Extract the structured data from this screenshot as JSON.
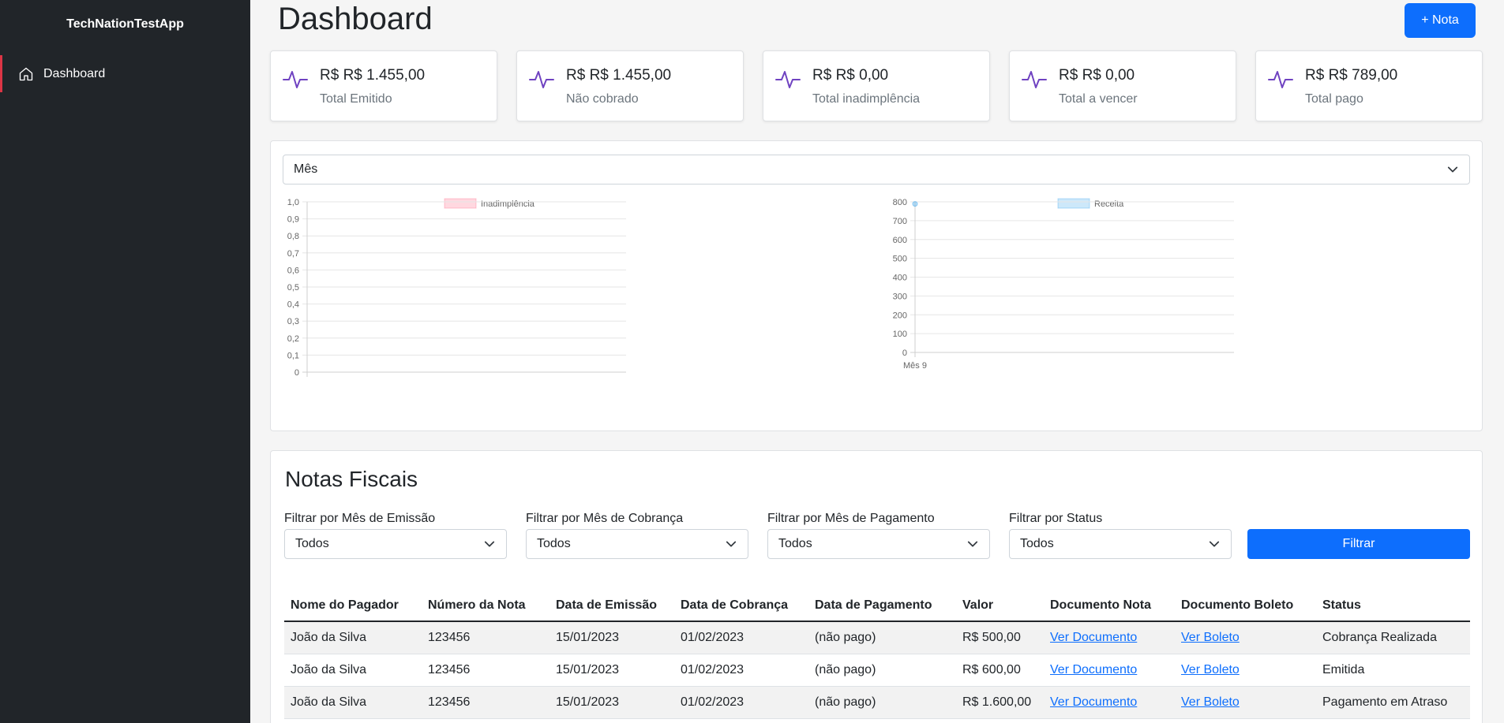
{
  "app": {
    "title": "TechNationTestApp"
  },
  "sidebar": {
    "items": [
      {
        "label": "Dashboard",
        "icon": "home-icon"
      }
    ]
  },
  "header": {
    "title": "Dashboard",
    "new_button": "+ Nota"
  },
  "summary_cards": [
    {
      "value": "R$ R$ 1.455,00",
      "label": "Total Emitido",
      "icon": "activity-icon"
    },
    {
      "value": "R$ R$ 1.455,00",
      "label": "Não cobrado",
      "icon": "activity-icon"
    },
    {
      "value": "R$ R$ 0,00",
      "label": "Total inadimplência",
      "icon": "activity-icon"
    },
    {
      "value": "R$ R$ 0,00",
      "label": "Total a vencer",
      "icon": "activity-icon"
    },
    {
      "value": "R$ R$ 789,00",
      "label": "Total pago",
      "icon": "activity-icon"
    }
  ],
  "period_select": {
    "value": "Mês"
  },
  "chart_data": [
    {
      "type": "line",
      "legend": "Inadimplência",
      "categories": [],
      "series": [
        {
          "name": "Inadimplência",
          "values": []
        }
      ],
      "yticks": [
        "1,0",
        "0,9",
        "0,8",
        "0,7",
        "0,6",
        "0,5",
        "0,4",
        "0,3",
        "0,2",
        "0,1",
        "0"
      ],
      "ylim": [
        0,
        1
      ],
      "grid": true,
      "legend_position": "top",
      "color": "#ff6384"
    },
    {
      "type": "line",
      "legend": "Receita",
      "categories": [
        "Mês 9"
      ],
      "series": [
        {
          "name": "Receita",
          "values": [
            789
          ]
        }
      ],
      "yticks": [
        "800",
        "700",
        "600",
        "500",
        "400",
        "300",
        "200",
        "100",
        "0"
      ],
      "ylim": [
        0,
        800
      ],
      "grid": true,
      "legend_position": "top",
      "color": "#36a2eb"
    }
  ],
  "notas": {
    "title": "Notas Fiscais",
    "filters": [
      {
        "label": "Filtrar por Mês de Emissão",
        "value": "Todos"
      },
      {
        "label": "Filtrar por Mês de Cobrança",
        "value": "Todos"
      },
      {
        "label": "Filtrar por Mês de Pagamento",
        "value": "Todos"
      },
      {
        "label": "Filtrar por Status",
        "value": "Todos"
      }
    ],
    "filter_button": "Filtrar",
    "columns": [
      "Nome do Pagador",
      "Número da Nota",
      "Data de Emissão",
      "Data de Cobrança",
      "Data de Pagamento",
      "Valor",
      "Documento Nota",
      "Documento Boleto",
      "Status"
    ],
    "rows": [
      [
        "João da Silva",
        "123456",
        "15/01/2023",
        "01/02/2023",
        "(não pago)",
        "R$ 500,00",
        "Ver Documento",
        "Ver Boleto",
        "Cobrança Realizada"
      ],
      [
        "João da Silva",
        "123456",
        "15/01/2023",
        "01/02/2023",
        "(não pago)",
        "R$ 600,00",
        "Ver Documento",
        "Ver Boleto",
        "Emitida"
      ],
      [
        "João da Silva",
        "123456",
        "15/01/2023",
        "01/02/2023",
        "(não pago)",
        "R$ 1.600,00",
        "Ver Documento",
        "Ver Boleto",
        "Pagamento em Atraso"
      ]
    ]
  },
  "colors": {
    "sidebar": "#212529",
    "primary": "#0d6efd",
    "accent_active": "#dc3545",
    "icon": "#6f42c1"
  }
}
